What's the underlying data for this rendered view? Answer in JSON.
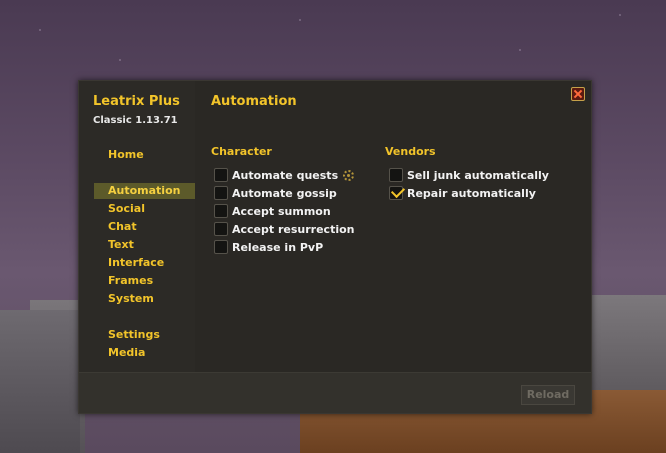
{
  "addon": {
    "title": "Leatrix Plus",
    "version": "Classic 1.13.71"
  },
  "sidebar": {
    "items": [
      {
        "label": "Home",
        "active": false
      },
      {
        "label": "Automation",
        "active": true
      },
      {
        "label": "Social",
        "active": false
      },
      {
        "label": "Chat",
        "active": false
      },
      {
        "label": "Text",
        "active": false
      },
      {
        "label": "Interface",
        "active": false
      },
      {
        "label": "Frames",
        "active": false
      },
      {
        "label": "System",
        "active": false
      },
      {
        "label": "Settings",
        "active": false
      },
      {
        "label": "Media",
        "active": false
      }
    ]
  },
  "main": {
    "title": "Automation",
    "groups": [
      {
        "title": "Character",
        "options": [
          {
            "label": "Automate quests",
            "checked": false,
            "has_settings": true
          },
          {
            "label": "Automate gossip",
            "checked": false
          },
          {
            "label": "Accept summon",
            "checked": false
          },
          {
            "label": "Accept resurrection",
            "checked": false
          },
          {
            "label": "Release in PvP",
            "checked": false
          }
        ]
      },
      {
        "title": "Vendors",
        "options": [
          {
            "label": "Sell junk automatically",
            "checked": false
          },
          {
            "label": "Repair automatically",
            "checked": true
          }
        ]
      }
    ]
  },
  "footer": {
    "reload_label": "Reload",
    "reload_enabled": false
  },
  "icons": {
    "close": "close-icon",
    "settings": "gear-icon"
  },
  "colors": {
    "accent": "#f2c42a",
    "panel": "#2a2824",
    "active_nav": "#5c5a2a"
  }
}
